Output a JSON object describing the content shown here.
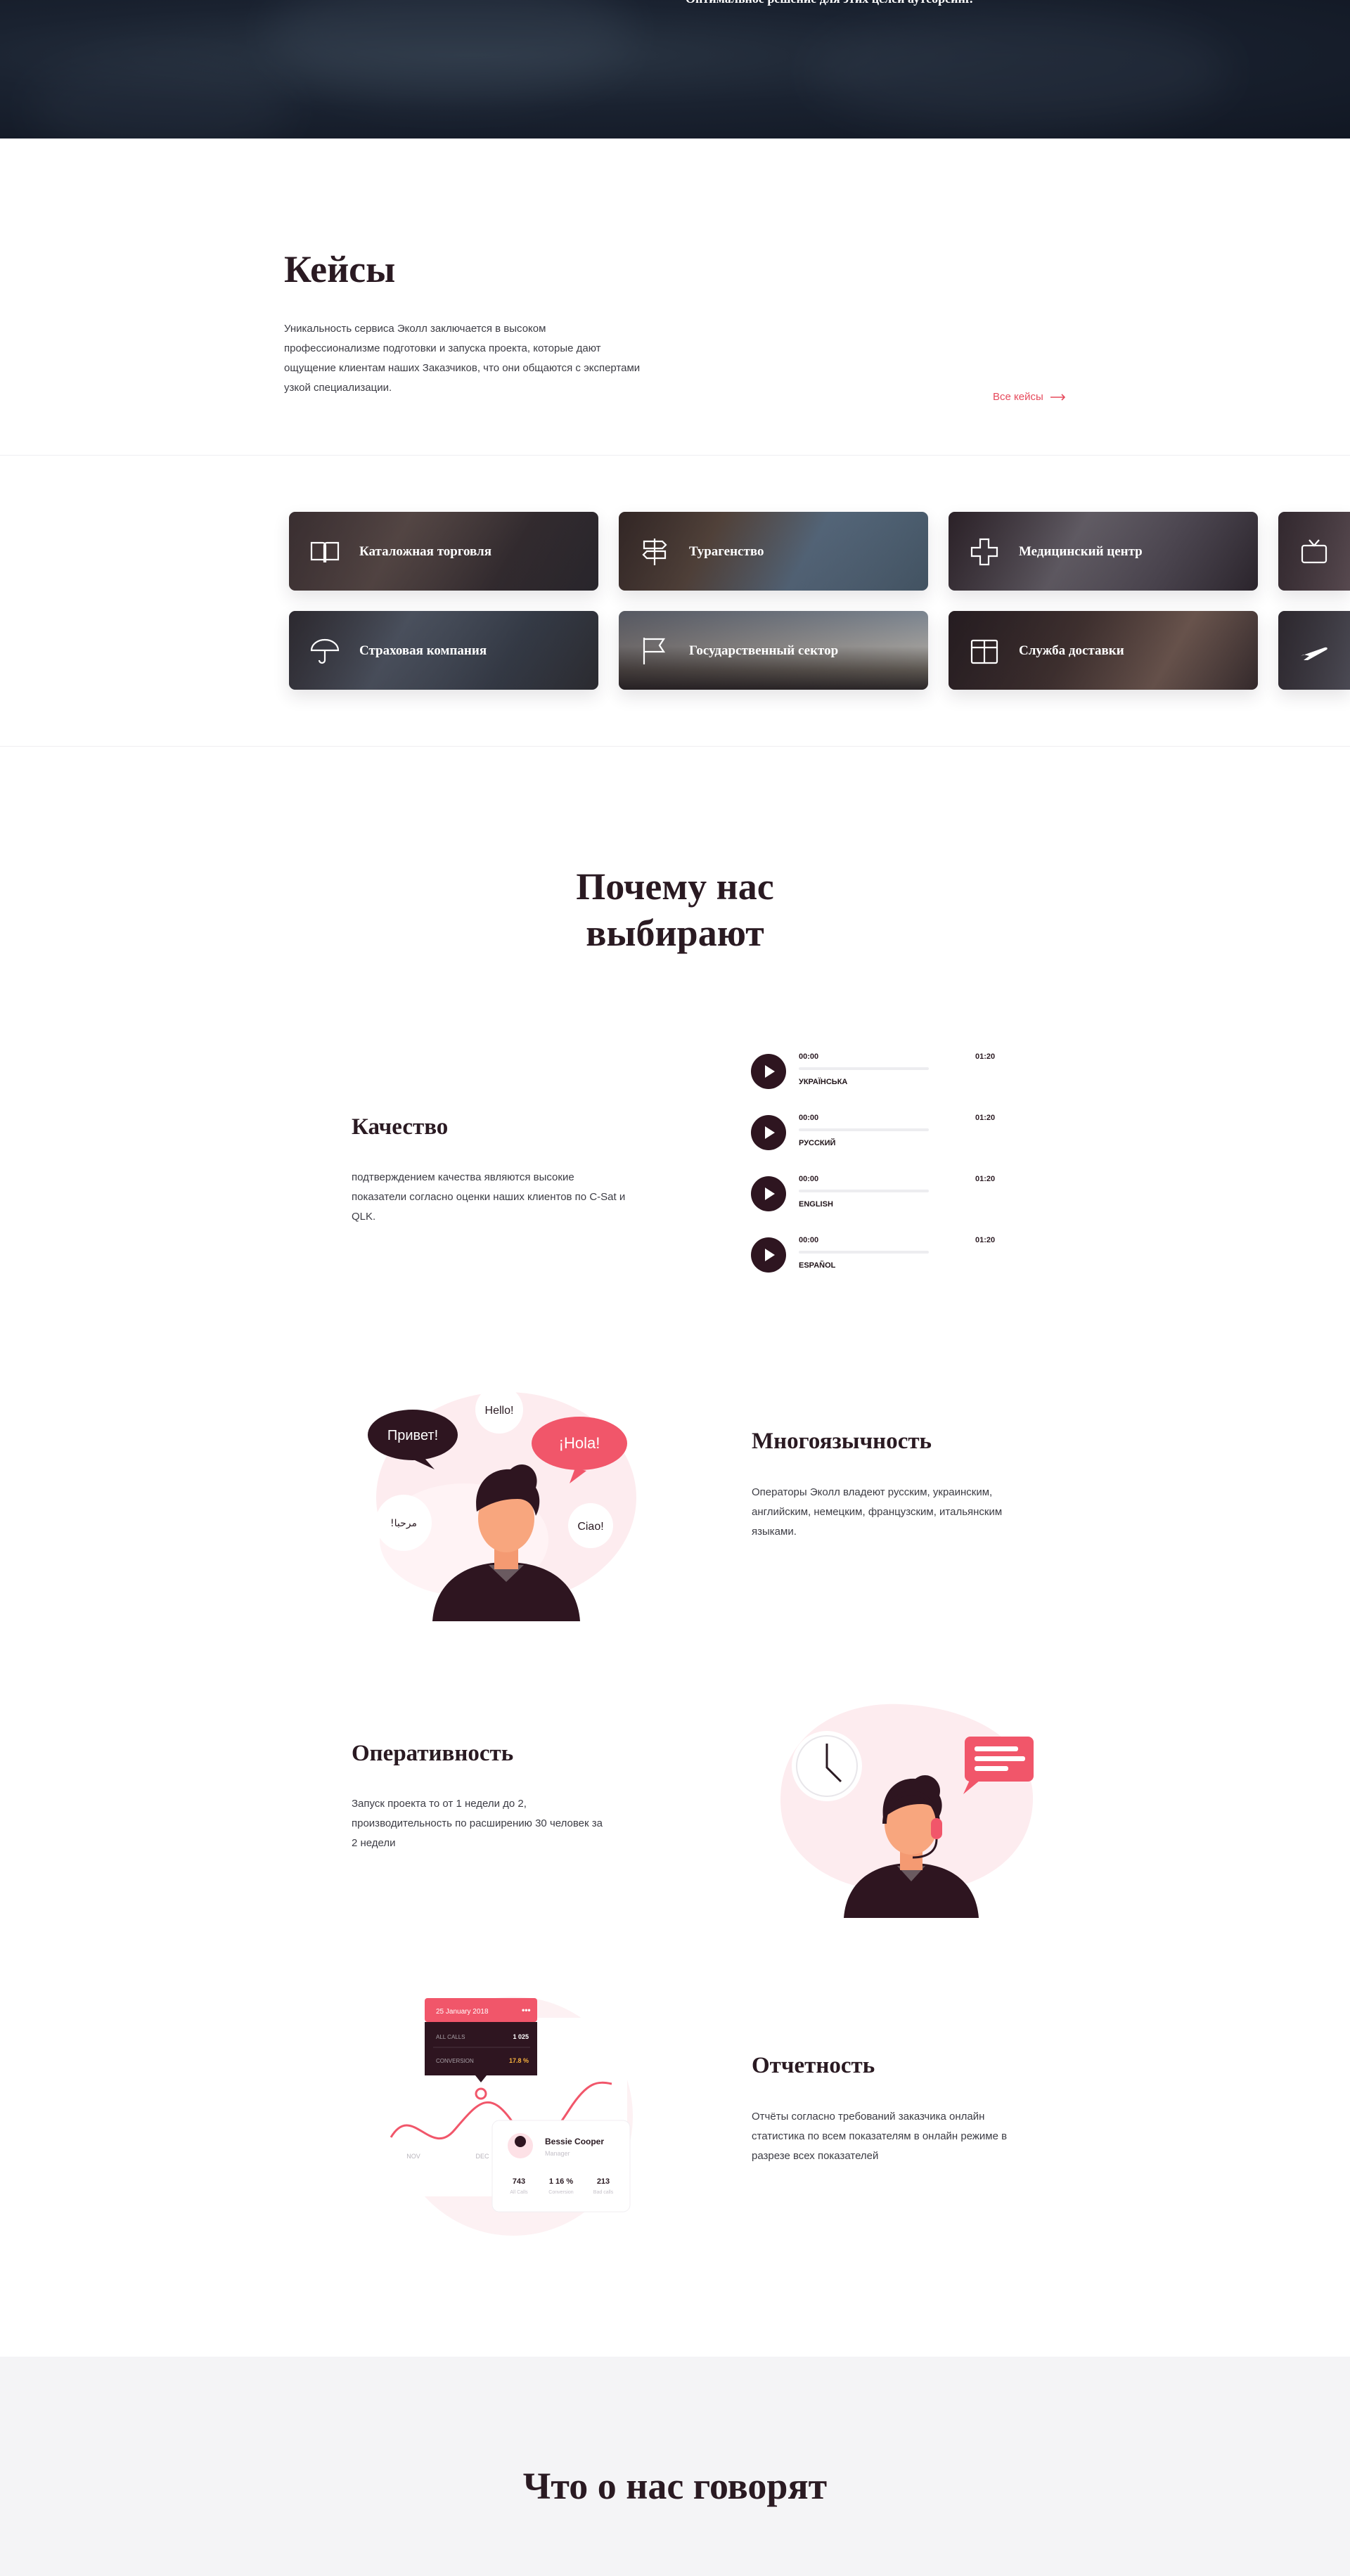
{
  "hero": {
    "title": "Оптимальное решение для этих целей аутсорсинг."
  },
  "cases": {
    "title": "Кейсы",
    "text": "Уникальность сервиса Эколл заключается в высоком профессионализме подготовки и запуска проекта, которые дают ощущение клиентам наших Заказчиков, что они общаются с экспертами узкой специализации.",
    "link_label": "Все кейсы",
    "items": [
      {
        "label": "Каталожная торговля",
        "icon": "book-icon"
      },
      {
        "label": "Турагенство",
        "icon": "signpost-icon"
      },
      {
        "label": "Медицинский центр",
        "icon": "medical-cross-icon"
      },
      {
        "label": "",
        "icon": "tv-icon"
      },
      {
        "label": "Страховая компания",
        "icon": "umbrella-icon"
      },
      {
        "label": "Государственный сектор",
        "icon": "flag-icon"
      },
      {
        "label": "Служба доставки",
        "icon": "box-icon"
      },
      {
        "label": "",
        "icon": "airplane-icon"
      }
    ]
  },
  "why": {
    "title_line1": "Почему нас",
    "title_line2": "выбирают",
    "features": [
      {
        "title": "Качество",
        "text": "подтверждением качества являются высокие показатели согласно оценки наших клиентов по C-Sat и QLK."
      },
      {
        "title": "Многоязычность",
        "text": "Операторы Эколл владеют русским, украинским, английским, немецким, французским, итальянским языками."
      },
      {
        "title": "Оперативность",
        "text": "Запуск проекта то от 1 недели до 2, производительность по расширению 30 человек за 2 недели"
      },
      {
        "title": "Отчетность",
        "text": "Отчёты согласно требований заказчика онлайн статистика по всем показателям в онлайн режиме в разрезе всех показателей"
      }
    ],
    "tracks": [
      {
        "start": "00:00",
        "end": "01:20",
        "lang": "УКРАЇНСЬКА"
      },
      {
        "start": "00:00",
        "end": "01:20",
        "lang": "РУССКИЙ"
      },
      {
        "start": "00:00",
        "end": "01:20",
        "lang": "ENGLISH"
      },
      {
        "start": "00:00",
        "end": "01:20",
        "lang": "ESPAÑOL"
      }
    ],
    "bubbles": {
      "privet": "Привет!",
      "hello": "Hello!",
      "hola": "¡Hola!",
      "arabic": "!مرحبا",
      "ciao": "Ciao!"
    },
    "report": {
      "date": "25 January 2018",
      "row1_label": "ALL CALLS",
      "row1_value": "1 025",
      "row2_label": "CONVERSION",
      "row2_value": "17.8 %",
      "name": "Bessie Cooper",
      "role": "Manager",
      "stat1": "743",
      "stat1_label": "All Calls",
      "stat2": "1 16 %",
      "stat2_label": "Conversion",
      "stat3": "213",
      "stat3_label": "Bad calls",
      "axis1": "NOV",
      "axis2": "DEC"
    }
  },
  "reviews": {
    "title": "Что о нас говорят"
  },
  "colors": {
    "accent": "#f1566a",
    "dark": "#2e1520",
    "text": "#3c3c44"
  }
}
